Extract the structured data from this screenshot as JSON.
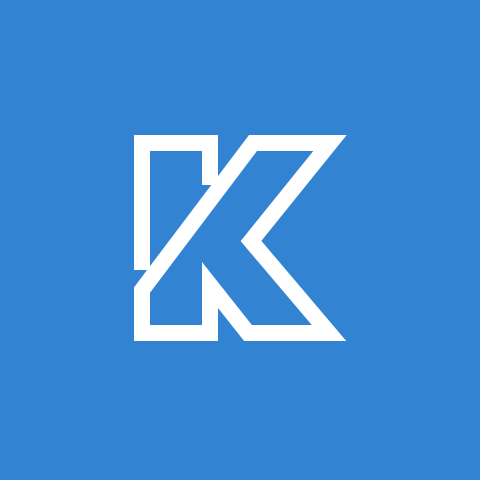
{
  "app_icon": {
    "background_color": "#3283d1",
    "glyph_color": "#ffffff",
    "glyph": "K",
    "icon_name": "k-letter-outline-logo-icon"
  }
}
